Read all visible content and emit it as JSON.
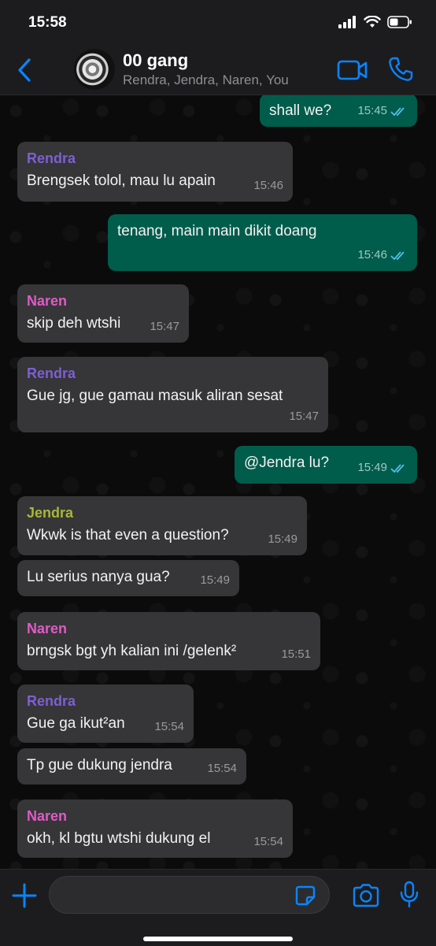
{
  "status_bar": {
    "time": "15:58"
  },
  "header": {
    "title": "00 gang",
    "members": "Rendra, Jendra, Naren, You"
  },
  "messages": [
    {
      "sender": "",
      "text": "shall we?",
      "time": "15:45"
    },
    {
      "sender": "Rendra",
      "text": "Brengsek tolol, mau lu apain",
      "time": "15:46"
    },
    {
      "sender": "",
      "text": "tenang, main main dikit doang",
      "time": "15:46"
    },
    {
      "sender": "Naren",
      "text": "skip deh wtshi",
      "time": "15:47"
    },
    {
      "sender": "Rendra",
      "text": "Gue jg, gue gamau masuk aliran sesat",
      "time": "15:47"
    },
    {
      "sender": "",
      "text": "@Jendra lu?",
      "time": "15:49"
    },
    {
      "sender": "Jendra",
      "text": "Wkwk is that even a question?",
      "time": "15:49"
    },
    {
      "sender": "",
      "text": "Lu serius nanya gua?",
      "time": "15:49"
    },
    {
      "sender": "Naren",
      "text": "brngsk bgt yh kalian ini /gelenk²",
      "time": "15:51"
    },
    {
      "sender": "Rendra",
      "text": "Gue ga ikut²an",
      "time": "15:54"
    },
    {
      "sender": "",
      "text": "Tp gue dukung jendra",
      "time": "15:54"
    },
    {
      "sender": "Naren",
      "text": "okh, kl bgtu wtshi dukung el",
      "time": "15:54"
    }
  ],
  "input": {
    "value": ""
  },
  "colors": {
    "accent": "#0a84ff",
    "outgoing_bubble": "#005c4b",
    "incoming_bubble": "#363638",
    "rendra": "#7d5fd4",
    "naren": "#e05ac7",
    "jendra": "#a9b738"
  }
}
